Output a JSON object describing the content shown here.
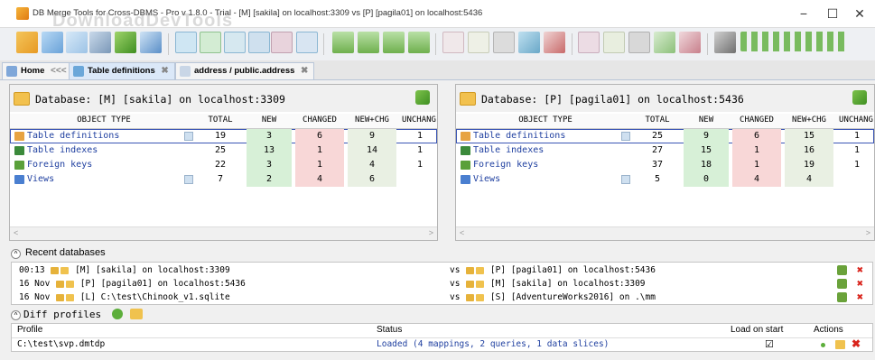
{
  "window": {
    "title": "DB Merge Tools for Cross-DBMS - Pro v 1.8.0 - Trial - [M] [sakila] on localhost:3309 vs [P] [pagila01] on localhost:5436",
    "watermark": "DownloadDevTools",
    "minimize": "−",
    "maximize": "☐",
    "close": "✕"
  },
  "tabs": [
    {
      "label": "Home",
      "suffix": "<<<",
      "close": "✖"
    },
    {
      "label": "Table definitions",
      "close": "✖"
    },
    {
      "label": "address / public.address",
      "close": "✖"
    }
  ],
  "left_panel": {
    "title": "Database: [M] [sakila] on localhost:3309",
    "columns": [
      "OBJECT TYPE",
      "TOTAL",
      "NEW",
      "CHANGED",
      "NEW+CHG",
      "UNCHANG"
    ],
    "rows": [
      {
        "name": "Table definitions",
        "total": "19",
        "new": "3",
        "changed": "6",
        "newchg": "9",
        "unch": "1",
        "icon": "#e7a341"
      },
      {
        "name": "Table indexes",
        "total": "25",
        "new": "13",
        "changed": "1",
        "newchg": "14",
        "unch": "1",
        "icon": "#3b8a3b"
      },
      {
        "name": "Foreign keys",
        "total": "22",
        "new": "3",
        "changed": "1",
        "newchg": "4",
        "unch": "1",
        "icon": "#5aa03a"
      },
      {
        "name": "Views",
        "total": "7",
        "new": "2",
        "changed": "4",
        "newchg": "6",
        "unch": "",
        "icon": "#4a7fd0"
      }
    ]
  },
  "right_panel": {
    "title": "Database: [P] [pagila01] on localhost:5436",
    "columns": [
      "OBJECT TYPE",
      "TOTAL",
      "NEW",
      "CHANGED",
      "NEW+CHG",
      "UNCHANG"
    ],
    "rows": [
      {
        "name": "Table definitions",
        "total": "25",
        "new": "9",
        "changed": "6",
        "newchg": "15",
        "unch": "1",
        "icon": "#e7a341"
      },
      {
        "name": "Table indexes",
        "total": "27",
        "new": "15",
        "changed": "1",
        "newchg": "16",
        "unch": "1",
        "icon": "#3b8a3b"
      },
      {
        "name": "Foreign keys",
        "total": "37",
        "new": "18",
        "changed": "1",
        "newchg": "19",
        "unch": "1",
        "icon": "#5aa03a"
      },
      {
        "name": "Views",
        "total": "5",
        "new": "0",
        "changed": "4",
        "newchg": "4",
        "unch": "",
        "icon": "#4a7fd0"
      }
    ]
  },
  "recent": {
    "title": "Recent databases",
    "toggle": "^",
    "rows": [
      {
        "date": "00:13",
        "left": "[M] [sakila] on localhost:3309",
        "vs": "vs",
        "right": "[P] [pagila01] on localhost:5436"
      },
      {
        "date": "16 Nov",
        "left": "[P] [pagila01] on localhost:5436",
        "vs": "vs",
        "right": "[M] [sakila] on localhost:3309"
      },
      {
        "date": "16 Nov",
        "left": "[L] C:\\test\\Chinook_v1.sqlite",
        "vs": "vs",
        "right": "[S] [AdventureWorks2016] on .\\mm"
      }
    ]
  },
  "diff_profiles": {
    "title": "Diff profiles",
    "toggle": "^",
    "columns": {
      "profile": "Profile",
      "status": "Status",
      "load": "Load on start",
      "actions": "Actions"
    },
    "rows": [
      {
        "profile": "C:\\test\\svp.dmtdp",
        "status": "Loaded (4 mappings, 2 queries, 1 data slices)",
        "load": "☑"
      }
    ]
  },
  "colors": {
    "link": "#2040a0",
    "new_bg": "#d7f0d7",
    "changed_bg": "#f8d7d7",
    "selection": "#3a55b5",
    "delete": "#d9241c"
  }
}
